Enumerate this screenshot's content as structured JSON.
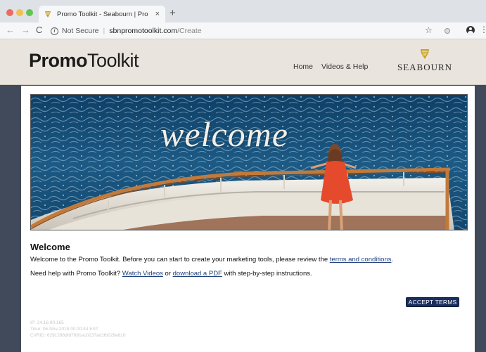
{
  "browser": {
    "tab_title": "Promo Toolkit - Seabourn | Pro",
    "tab_close": "×",
    "new_tab": "+",
    "nav_back": "←",
    "nav_forward": "→",
    "nav_reload": "C",
    "info_glyph": "i",
    "security_label": "Not Secure",
    "separator": "|",
    "url_host": "sbnpromotoolkit.com",
    "url_path": "/Create",
    "star_glyph": "☆",
    "menu_glyph": "⋮"
  },
  "header": {
    "logo_bold": "Promo",
    "logo_light": "Toolkit",
    "nav": [
      "Home",
      "Videos & Help"
    ],
    "brand_name": "SEABOURN"
  },
  "hero": {
    "overlay_text": "welcome"
  },
  "content": {
    "heading": "Welcome",
    "para1_prefix": "Welcome to the Promo Toolkit. Before you can start to create your marketing tools, please review the ",
    "para1_link": "terms and conditions",
    "para1_suffix": ".",
    "para2_prefix": "Need help with Promo Toolkit? ",
    "para2_link1": "Watch Videos",
    "para2_middle": " or ",
    "para2_link2": "download a PDF",
    "para2_suffix": " with step-by-step instructions.",
    "accept_button": "ACCEPT TERMS"
  },
  "meta": {
    "ip": "IP: 24.16.90.165",
    "time": "Time: 06-Nov-2018 00:20:44 EST",
    "cvrid": "CVRID: 6291288dfd7891ec0237ad1fb029e810"
  },
  "colors": {
    "header_bg": "#eae4de",
    "page_bg": "#414a5a",
    "button_bg": "#1b2e5e",
    "link": "#1f3f7a",
    "brand_gold": "#c9a227"
  },
  "icons": [
    "info-icon",
    "star-icon",
    "extension-icon",
    "profile-icon",
    "menu-icon",
    "seabourn-emblem-icon"
  ]
}
